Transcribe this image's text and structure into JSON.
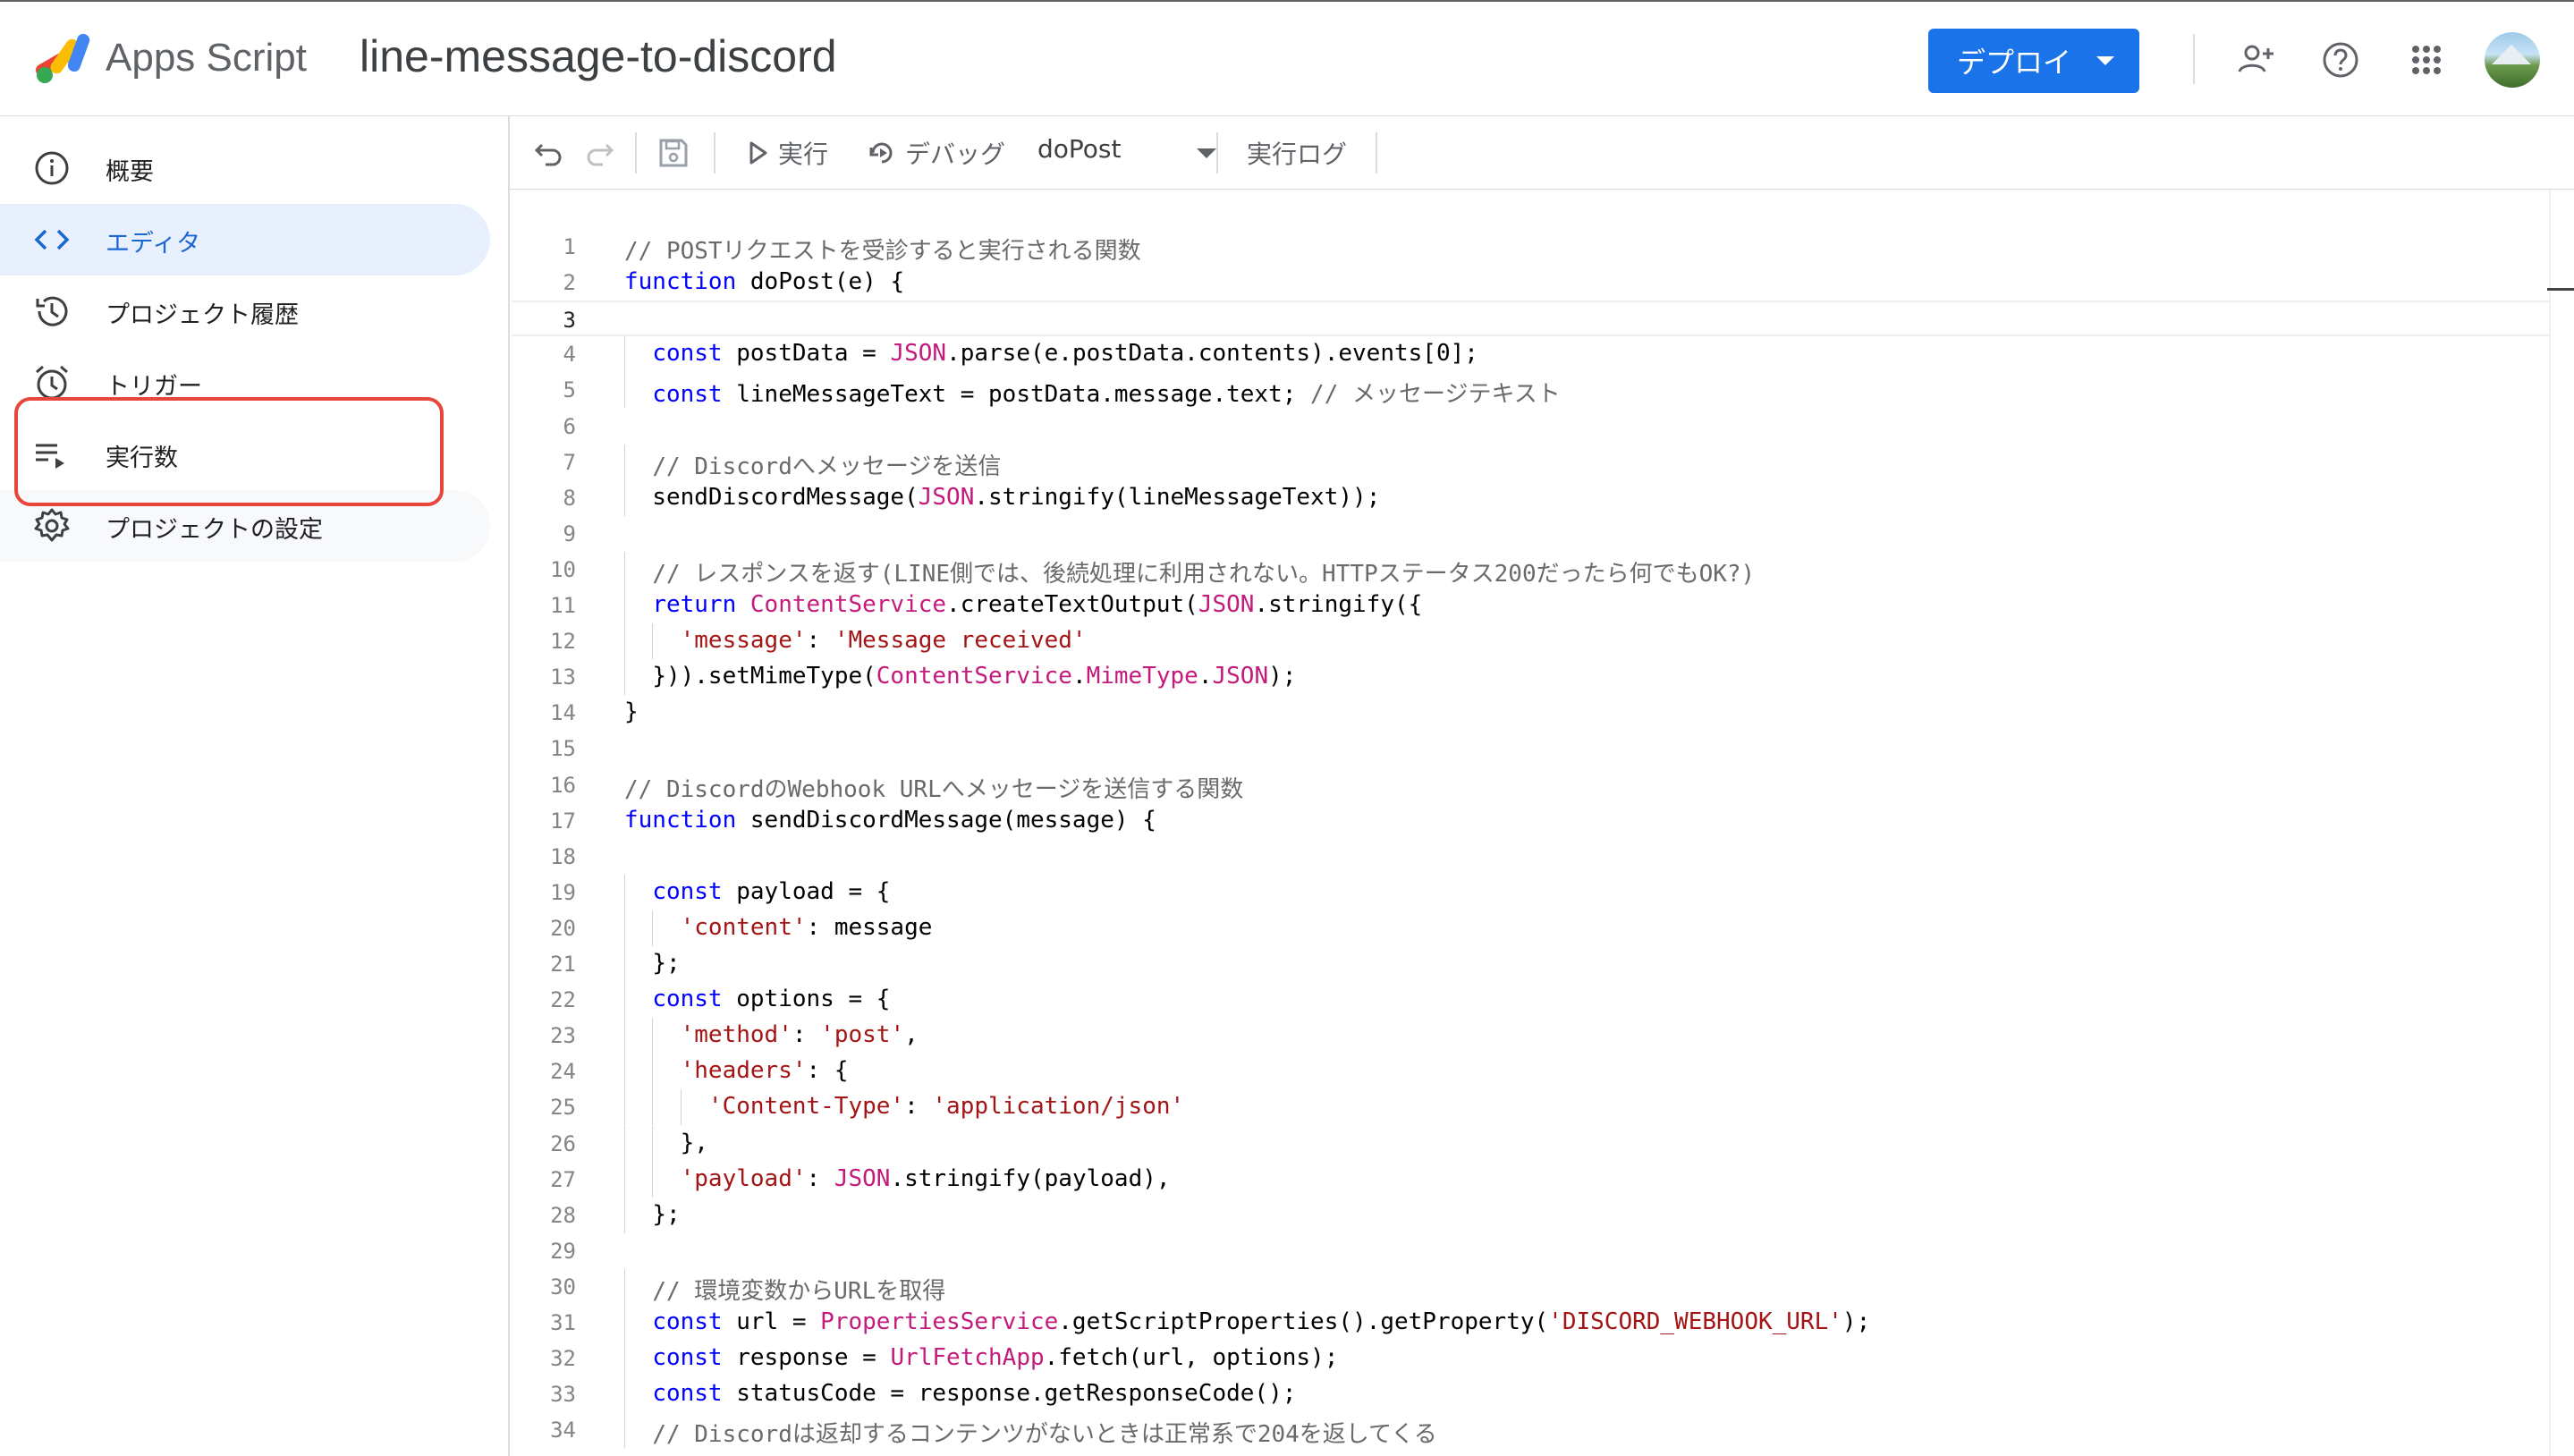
{
  "header": {
    "app_name": "Apps Script",
    "project_name": "line-message-to-discord",
    "deploy_label": "デプロイ",
    "icons": [
      "add-person-icon",
      "help-icon",
      "apps-grid-icon"
    ],
    "accent_color": "#1a73e8"
  },
  "sidebar": {
    "items": [
      {
        "label": "概要",
        "icon": "info-icon"
      },
      {
        "label": "エディタ",
        "icon": "code-icon"
      },
      {
        "label": "プロジェクト履歴",
        "icon": "history-icon"
      },
      {
        "label": "トリガー",
        "icon": "alarm-icon"
      },
      {
        "label": "実行数",
        "icon": "executions-icon"
      },
      {
        "label": "プロジェクトの設定",
        "icon": "settings-icon"
      }
    ],
    "active_index": 1,
    "highlight_color": "#e8453c"
  },
  "toolbar": {
    "run_label": "実行",
    "debug_label": "デバッグ",
    "function_name": "doPost",
    "log_label": "実行ログ"
  },
  "editor": {
    "current_line": 3,
    "lines": [
      {
        "n": "1",
        "code": "// POSTリクエストを受診すると実行される関数"
      },
      {
        "n": "2",
        "code": "function doPost(e) {"
      },
      {
        "n": "3",
        "code": ""
      },
      {
        "n": "4",
        "code": "  const postData = JSON.parse(e.postData.contents).events[0];"
      },
      {
        "n": "5",
        "code": "  const lineMessageText = postData.message.text; // メッセージテキスト"
      },
      {
        "n": "6",
        "code": ""
      },
      {
        "n": "7",
        "code": "  // Discordへメッセージを送信"
      },
      {
        "n": "8",
        "code": "  sendDiscordMessage(JSON.stringify(lineMessageText));"
      },
      {
        "n": "9",
        "code": ""
      },
      {
        "n": "10",
        "code": "  // レスポンスを返す(LINE側では、後続処理に利用されない。HTTPステータス200だったら何でもOK?)"
      },
      {
        "n": "11",
        "code": "  return ContentService.createTextOutput(JSON.stringify({"
      },
      {
        "n": "12",
        "code": "    'message': 'Message received'"
      },
      {
        "n": "13",
        "code": "  })).setMimeType(ContentService.MimeType.JSON);"
      },
      {
        "n": "14",
        "code": "}"
      },
      {
        "n": "15",
        "code": ""
      },
      {
        "n": "16",
        "code": "// DiscordのWebhook URLへメッセージを送信する関数"
      },
      {
        "n": "17",
        "code": "function sendDiscordMessage(message) {"
      },
      {
        "n": "18",
        "code": ""
      },
      {
        "n": "19",
        "code": "  const payload = {"
      },
      {
        "n": "20",
        "code": "    'content': message"
      },
      {
        "n": "21",
        "code": "  };"
      },
      {
        "n": "22",
        "code": "  const options = {"
      },
      {
        "n": "23",
        "code": "    'method': 'post',"
      },
      {
        "n": "24",
        "code": "    'headers': {"
      },
      {
        "n": "25",
        "code": "      'Content-Type': 'application/json'"
      },
      {
        "n": "26",
        "code": "    },"
      },
      {
        "n": "27",
        "code": "    'payload': JSON.stringify(payload),"
      },
      {
        "n": "28",
        "code": "  };"
      },
      {
        "n": "29",
        "code": ""
      },
      {
        "n": "30",
        "code": "  // 環境変数からURLを取得"
      },
      {
        "n": "31",
        "code": "  const url = PropertiesService.getScriptProperties().getProperty('DISCORD_WEBHOOK_URL');"
      },
      {
        "n": "32",
        "code": "  const response = UrlFetchApp.fetch(url, options);"
      },
      {
        "n": "33",
        "code": "  const statusCode = response.getResponseCode();"
      },
      {
        "n": "34",
        "code": "  // Discordは返却するコンテンツがないときは正常系で204を返してくる"
      }
    ]
  }
}
